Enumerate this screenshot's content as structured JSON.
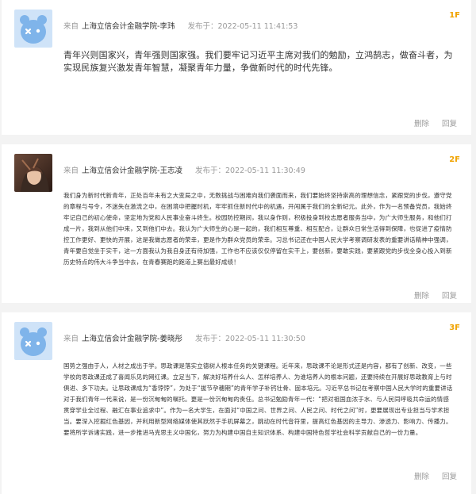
{
  "comments": [
    {
      "floor": "1F",
      "from_label": "来自",
      "school": "上海立信会计金融学院-李玮",
      "time_label": "发布于",
      "time": "2022-05-11 11:41:53",
      "content": "青年兴则国家兴，青年强则国家强。我们要牢记习近平主席对我们的勉励，立鸿鹄志，做奋斗者，为实现民族复兴激发青年智慧，凝聚青年力量，争做新时代的时代先锋。",
      "delete_label": "删除",
      "reply_label": "回复",
      "avatar": "default-bear-avatar"
    },
    {
      "floor": "2F",
      "from_label": "来自",
      "school": "上海立信会计金融学院-王志凌",
      "time_label": "发布于",
      "time": "2022-05-11 11:30:49",
      "content": "我们身为新时代新青年，正处百年未有之大变局之中，无数挑战与困难向我们袭面而来，我们要始终坚持崇高的理想信念，紧跟党的步伐，遵守党的章程与号令，不迷失在激流之中，在困境中把握时机，牢牢抓住新时代中的机遇，开闯属于我们的全新纪元。此外，作为一名预备党员，我始终牢记自己的初心使命，坚定地为党和人民事业奋斗终生。校园防控期间，我以身作则，积极投身到校志愿者服务当中，为广大师生服务，和他们打成一片，我到从他们中来，又到他们中去。我认为广大师生的心是一起的，我们相互尊重、相互配合，让群众日常生活得到保障，也促进了疫情防控工作更好、更快的开展，这是我做志愿者的荣幸，更是作为群众党员的荣幸。习总书记还在中国人民大学考察调研发表的重要讲话精神中强调，青年要自觉坐于实干，这一方面我认为我自身还有待加强，工作也不应该仅仅停留在实干上，要创新，要敢实践，要紧跟党的步伐全身心投入到新历史特点的伟大斗争当中去，在青春赛跑的跑道上赛出最好成绩！",
      "delete_label": "删除",
      "reply_label": "回复",
      "avatar": "anime-photo-avatar"
    },
    {
      "floor": "3F",
      "from_label": "来自",
      "school": "上海立信会计金融学院-姜晓彤",
      "time_label": "发布于",
      "time": "2022-05-11 11:30:50",
      "content": "国势之强由于人，人材之成出于学。思政课是落实立德树人根本任务的关键课程。近年来，思政课不论是形式还是内容，都有了创新、改变，一些学校的思政课还成了喜闻乐见的网红课。立足当下，解决好培养什么人、怎样培养人、为谁培养人的根本问题，还要持续在开展好思政教育上与时俱进、多下功夫。让思政课成为“香饽饽”，为处于“拔节孕穗期”的青年学子补钙壮骨、固本培元。习近平总书记在考察中国人民大学时的重要讲话对于我们青年一代来说，是一份沉甸甸的嘱托。更是一份沉甸甸的责任。总书记勉励青年一代：“把对祖国血浓于水、与人民同呼吸共命运的情感贯穿学业全过程、融汇在事业追求中”。作为一名大学生，在面对“中国之问、世界之问、人民之问、时代之问”时，更要展现出专业担当与学术担当。要深入挖掘红色基因，并利用新型网络媒体使其跃然于手机屏幕之，跳动在时代音符里，提高红色基因的主导力、渗透力、影响力、传播力。要将所学诉诸实践，进一步推进马克思主义中国化，努力为构建中国自主知识体系、构建中国特色哲学社会科学贡献自己的一份力量。",
      "delete_label": "删除",
      "reply_label": "回复",
      "avatar": "default-bear-avatar"
    }
  ],
  "colors": {
    "floor": "#f0a300",
    "page_background": "#f3f3f3",
    "avatar_background": "#cfe3f8",
    "avatar_bear": "#7fb4ea"
  }
}
